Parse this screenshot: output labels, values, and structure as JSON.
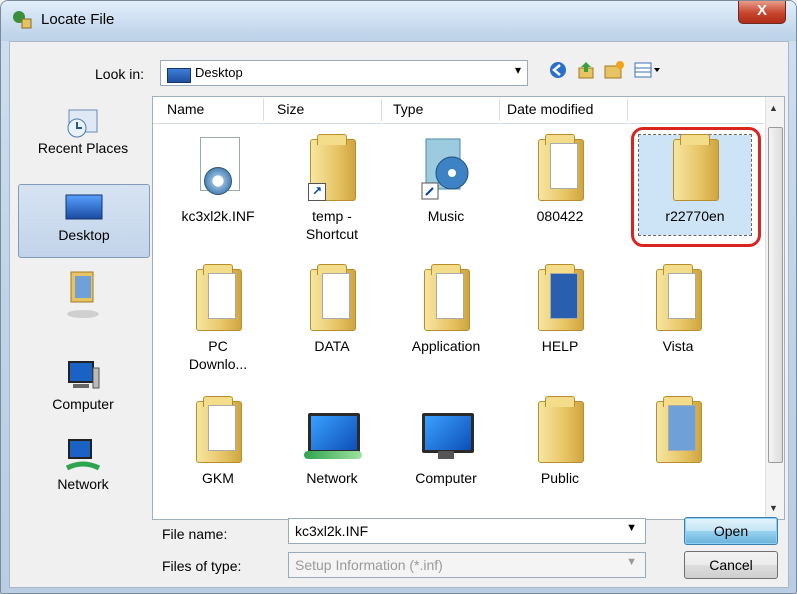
{
  "window": {
    "title": "Locate File",
    "close_label": "X"
  },
  "lookin": {
    "label": "Look in:",
    "value": "Desktop"
  },
  "toolbar": {
    "back_icon": "back-arrow-icon",
    "up_icon": "up-folder-icon",
    "new_folder_icon": "new-folder-icon",
    "views_icon": "views-menu-icon"
  },
  "places": [
    {
      "label": "Recent Places",
      "icon": "recent-places-icon"
    },
    {
      "label": "Desktop",
      "icon": "desktop-icon"
    },
    {
      "label": "",
      "icon": "user-folder-icon"
    },
    {
      "label": "Computer",
      "icon": "computer-icon"
    },
    {
      "label": "Network",
      "icon": "network-icon"
    }
  ],
  "columns": [
    "Name",
    "Size",
    "Type",
    "Date modified"
  ],
  "items": [
    {
      "label": "kc3xl2k.INF",
      "icon": "setup-file-icon"
    },
    {
      "label": "temp -\nShortcut",
      "icon": "folder-shortcut-icon"
    },
    {
      "label": "Music",
      "icon": "music-shortcut-icon"
    },
    {
      "label": "080422",
      "icon": "folder-icon"
    },
    {
      "label": "r22770en",
      "icon": "folder-icon"
    },
    {
      "label": "PC\nDownlo...",
      "icon": "folder-icon"
    },
    {
      "label": "DATA",
      "icon": "folder-icon"
    },
    {
      "label": "Application",
      "icon": "folder-icon"
    },
    {
      "label": "HELP",
      "icon": "folder-icon"
    },
    {
      "label": "Vista",
      "icon": "folder-icon"
    },
    {
      "label": "GKM",
      "icon": "folder-icon"
    },
    {
      "label": "Network",
      "icon": "network-icon"
    },
    {
      "label": "Computer",
      "icon": "computer-icon"
    },
    {
      "label": "Public",
      "icon": "folder-icon"
    },
    {
      "label": "",
      "icon": "user-folder-icon"
    }
  ],
  "bottom": {
    "filename_label": "File name:",
    "filename_value": "kc3xl2k.INF",
    "filetype_label": "Files of type:",
    "filetype_value": "Setup Information (*.inf)",
    "open_label": "Open",
    "cancel_label": "Cancel"
  },
  "colors": {
    "highlight_ring": "#d8251f",
    "selection": "#cde4f7",
    "close_button": "#c7432c"
  }
}
